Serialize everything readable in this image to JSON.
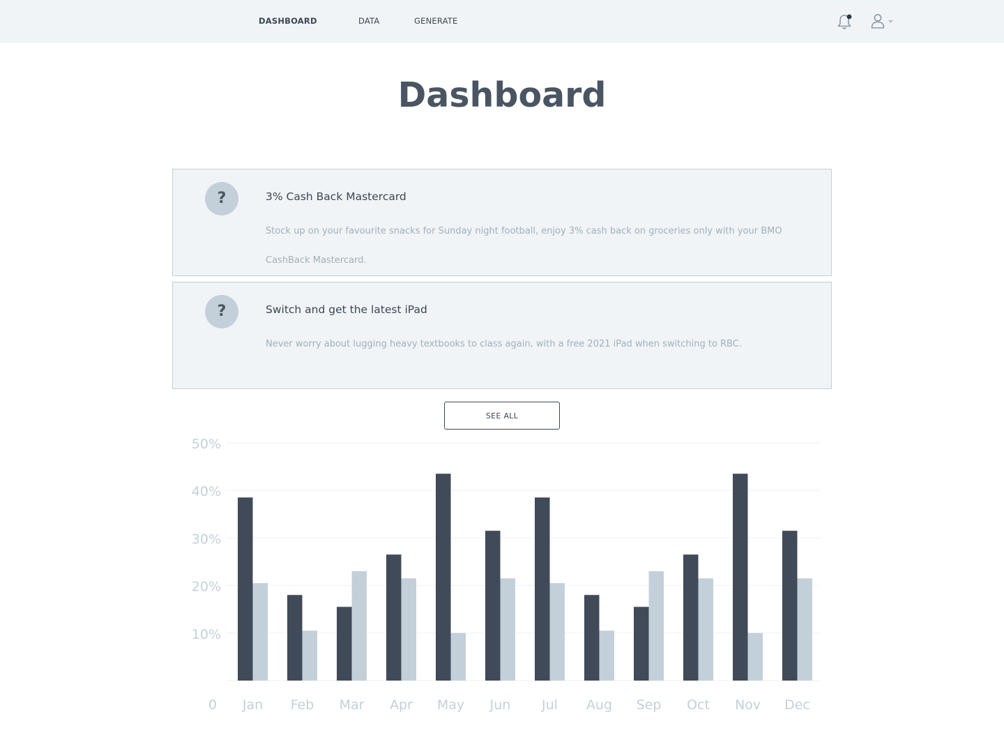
{
  "nav": {
    "items": [
      "DASHBOARD",
      "DATA",
      "GENERATE"
    ],
    "icons": [
      "bell-icon",
      "user-icon",
      "caret-down-icon"
    ]
  },
  "page": {
    "title": "Dashboard"
  },
  "cards": [
    {
      "icon": "?",
      "title": "3% Cash Back Mastercard",
      "body": "Stock up on your favourite snacks for Sunday night football, enjoy 3% cash back on groceries only with your BMO CashBack Mastercard."
    },
    {
      "icon": "?",
      "title": "Switch and get the latest iPad",
      "body": "Never worry about lugging heavy textbooks to class again, with a free 2021 iPad when switching to RBC."
    }
  ],
  "see_all_label": "SEE ALL",
  "colors": {
    "dark_bar": "#414a58",
    "light_bar": "#c3d0d9",
    "nav_bg": "#f0f4f7",
    "axis_text": "#c3d0d9"
  },
  "chart_data": {
    "type": "bar",
    "categories": [
      "Jan",
      "Feb",
      "Mar",
      "Apr",
      "May",
      "Jun",
      "Jul",
      "Aug",
      "Sep",
      "Oct",
      "Nov",
      "Dec"
    ],
    "series": [
      {
        "color": "#414a58",
        "values": [
          38.5,
          18,
          15.5,
          26.5,
          43.5,
          31.5,
          38.5,
          18,
          15.5,
          26.5,
          43.5,
          31.5
        ]
      },
      {
        "color": "#c3d0d9",
        "values": [
          20.5,
          10.5,
          23,
          21.5,
          10,
          21.5,
          20.5,
          10.5,
          23,
          21.5,
          10,
          21.5
        ]
      }
    ],
    "ylim": [
      0,
      50
    ],
    "yticks": [
      "0",
      "10%",
      "20%",
      "30%",
      "40%",
      "50%"
    ],
    "ytick_values": [
      0,
      10,
      20,
      30,
      40,
      50
    ],
    "grid": true
  }
}
